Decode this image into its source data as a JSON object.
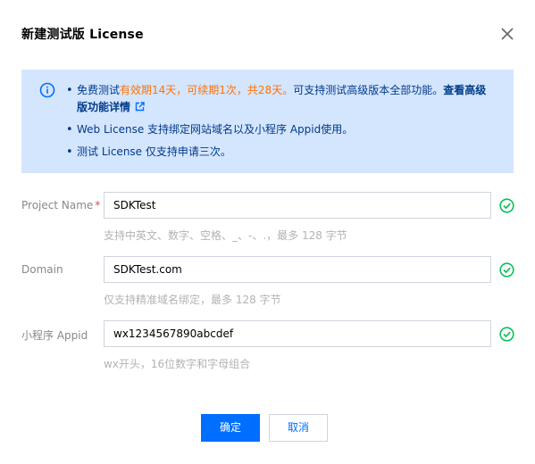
{
  "dialog": {
    "title": "新建测试版 License"
  },
  "notice": {
    "item1_prefix": "免费测试",
    "item1_highlight": "有效期14天，可续期1次，共28天。",
    "item1_suffix": "可支持测试高级版本全部功能。",
    "item1_link": "查看高级版功能详情",
    "item2": "Web License 支持绑定网站域名以及小程序 Appid使用。",
    "item3": "测试 License 仅支持申请三次。"
  },
  "form": {
    "project_name": {
      "label": "Project Name",
      "required_mark": "*",
      "value": "SDKTest",
      "hint": "支持中英文、数字、空格、_、-、.，最多 128 字节"
    },
    "domain": {
      "label": "Domain",
      "value": "SDKTest.com",
      "hint": "仅支持精准域名绑定，最多 128 字节"
    },
    "appid": {
      "label": "小程序 Appid",
      "value": "wx1234567890abcdef",
      "hint": "wx开头，16位数字和字母组合"
    }
  },
  "buttons": {
    "confirm": "确定",
    "cancel": "取消"
  },
  "colors": {
    "primary": "#006eff",
    "notice_bg": "#d4e5fe",
    "notice_text": "#003b8a",
    "highlight": "#ff7200",
    "success": "#0abf5b",
    "required": "#e54545"
  },
  "icons": {
    "close": "close-icon",
    "info": "info-icon",
    "external_link": "external-link-icon",
    "check": "check-circle-icon"
  }
}
